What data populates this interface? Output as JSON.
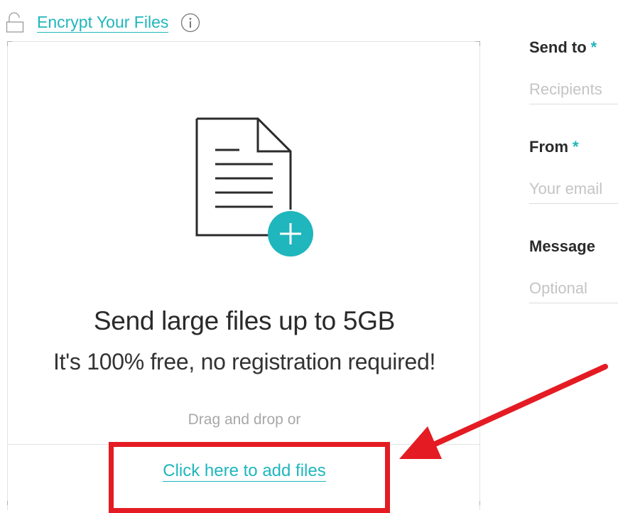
{
  "encrypt": {
    "link_label": "Encrypt Your Files",
    "lock_icon": "lock-open-icon",
    "info_icon": "info-icon"
  },
  "upload": {
    "graphic_icon": "document-add-icon",
    "headline": "Send large files up to 5GB",
    "subhead": "It's 100% free, no registration required!",
    "drag_text": "Drag and drop or",
    "add_files_link": "Click here to add files"
  },
  "form": {
    "send_to": {
      "label": "Send to",
      "required_mark": "*",
      "placeholder": "Recipients"
    },
    "from": {
      "label": "From",
      "required_mark": "*",
      "placeholder": "Your email"
    },
    "message": {
      "label": "Message",
      "placeholder": "Optional"
    }
  },
  "colors": {
    "accent": "#1fb6bd",
    "annotation": "#e41b23",
    "text": "#2a2a2a",
    "muted": "#a8a8a8"
  }
}
